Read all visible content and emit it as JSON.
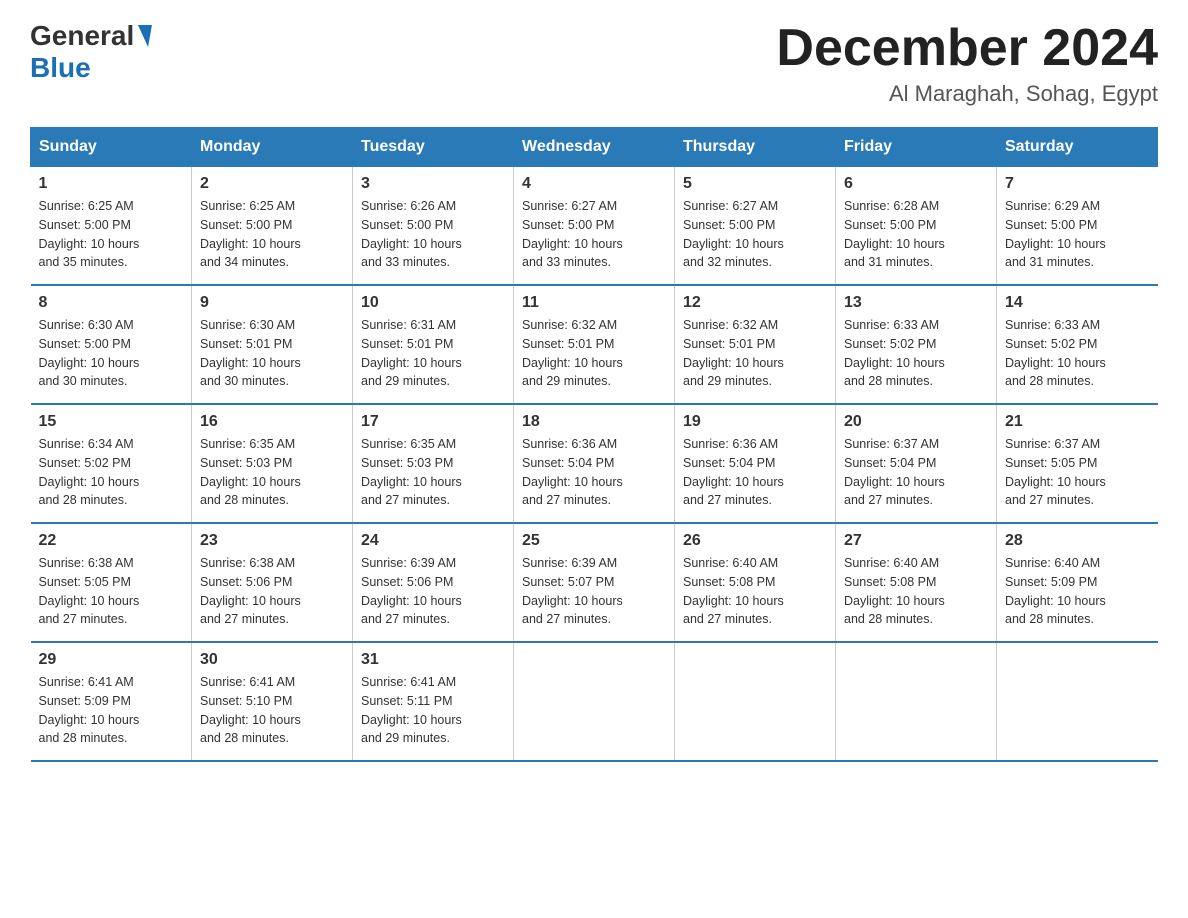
{
  "header": {
    "logo_general": "General",
    "logo_blue": "Blue",
    "month_title": "December 2024",
    "location": "Al Maraghah, Sohag, Egypt"
  },
  "columns": [
    "Sunday",
    "Monday",
    "Tuesday",
    "Wednesday",
    "Thursday",
    "Friday",
    "Saturday"
  ],
  "weeks": [
    [
      {
        "day": "1",
        "info": "Sunrise: 6:25 AM\nSunset: 5:00 PM\nDaylight: 10 hours\nand 35 minutes."
      },
      {
        "day": "2",
        "info": "Sunrise: 6:25 AM\nSunset: 5:00 PM\nDaylight: 10 hours\nand 34 minutes."
      },
      {
        "day": "3",
        "info": "Sunrise: 6:26 AM\nSunset: 5:00 PM\nDaylight: 10 hours\nand 33 minutes."
      },
      {
        "day": "4",
        "info": "Sunrise: 6:27 AM\nSunset: 5:00 PM\nDaylight: 10 hours\nand 33 minutes."
      },
      {
        "day": "5",
        "info": "Sunrise: 6:27 AM\nSunset: 5:00 PM\nDaylight: 10 hours\nand 32 minutes."
      },
      {
        "day": "6",
        "info": "Sunrise: 6:28 AM\nSunset: 5:00 PM\nDaylight: 10 hours\nand 31 minutes."
      },
      {
        "day": "7",
        "info": "Sunrise: 6:29 AM\nSunset: 5:00 PM\nDaylight: 10 hours\nand 31 minutes."
      }
    ],
    [
      {
        "day": "8",
        "info": "Sunrise: 6:30 AM\nSunset: 5:00 PM\nDaylight: 10 hours\nand 30 minutes."
      },
      {
        "day": "9",
        "info": "Sunrise: 6:30 AM\nSunset: 5:01 PM\nDaylight: 10 hours\nand 30 minutes."
      },
      {
        "day": "10",
        "info": "Sunrise: 6:31 AM\nSunset: 5:01 PM\nDaylight: 10 hours\nand 29 minutes."
      },
      {
        "day": "11",
        "info": "Sunrise: 6:32 AM\nSunset: 5:01 PM\nDaylight: 10 hours\nand 29 minutes."
      },
      {
        "day": "12",
        "info": "Sunrise: 6:32 AM\nSunset: 5:01 PM\nDaylight: 10 hours\nand 29 minutes."
      },
      {
        "day": "13",
        "info": "Sunrise: 6:33 AM\nSunset: 5:02 PM\nDaylight: 10 hours\nand 28 minutes."
      },
      {
        "day": "14",
        "info": "Sunrise: 6:33 AM\nSunset: 5:02 PM\nDaylight: 10 hours\nand 28 minutes."
      }
    ],
    [
      {
        "day": "15",
        "info": "Sunrise: 6:34 AM\nSunset: 5:02 PM\nDaylight: 10 hours\nand 28 minutes."
      },
      {
        "day": "16",
        "info": "Sunrise: 6:35 AM\nSunset: 5:03 PM\nDaylight: 10 hours\nand 28 minutes."
      },
      {
        "day": "17",
        "info": "Sunrise: 6:35 AM\nSunset: 5:03 PM\nDaylight: 10 hours\nand 27 minutes."
      },
      {
        "day": "18",
        "info": "Sunrise: 6:36 AM\nSunset: 5:04 PM\nDaylight: 10 hours\nand 27 minutes."
      },
      {
        "day": "19",
        "info": "Sunrise: 6:36 AM\nSunset: 5:04 PM\nDaylight: 10 hours\nand 27 minutes."
      },
      {
        "day": "20",
        "info": "Sunrise: 6:37 AM\nSunset: 5:04 PM\nDaylight: 10 hours\nand 27 minutes."
      },
      {
        "day": "21",
        "info": "Sunrise: 6:37 AM\nSunset: 5:05 PM\nDaylight: 10 hours\nand 27 minutes."
      }
    ],
    [
      {
        "day": "22",
        "info": "Sunrise: 6:38 AM\nSunset: 5:05 PM\nDaylight: 10 hours\nand 27 minutes."
      },
      {
        "day": "23",
        "info": "Sunrise: 6:38 AM\nSunset: 5:06 PM\nDaylight: 10 hours\nand 27 minutes."
      },
      {
        "day": "24",
        "info": "Sunrise: 6:39 AM\nSunset: 5:06 PM\nDaylight: 10 hours\nand 27 minutes."
      },
      {
        "day": "25",
        "info": "Sunrise: 6:39 AM\nSunset: 5:07 PM\nDaylight: 10 hours\nand 27 minutes."
      },
      {
        "day": "26",
        "info": "Sunrise: 6:40 AM\nSunset: 5:08 PM\nDaylight: 10 hours\nand 27 minutes."
      },
      {
        "day": "27",
        "info": "Sunrise: 6:40 AM\nSunset: 5:08 PM\nDaylight: 10 hours\nand 28 minutes."
      },
      {
        "day": "28",
        "info": "Sunrise: 6:40 AM\nSunset: 5:09 PM\nDaylight: 10 hours\nand 28 minutes."
      }
    ],
    [
      {
        "day": "29",
        "info": "Sunrise: 6:41 AM\nSunset: 5:09 PM\nDaylight: 10 hours\nand 28 minutes."
      },
      {
        "day": "30",
        "info": "Sunrise: 6:41 AM\nSunset: 5:10 PM\nDaylight: 10 hours\nand 28 minutes."
      },
      {
        "day": "31",
        "info": "Sunrise: 6:41 AM\nSunset: 5:11 PM\nDaylight: 10 hours\nand 29 minutes."
      },
      {
        "day": "",
        "info": ""
      },
      {
        "day": "",
        "info": ""
      },
      {
        "day": "",
        "info": ""
      },
      {
        "day": "",
        "info": ""
      }
    ]
  ]
}
